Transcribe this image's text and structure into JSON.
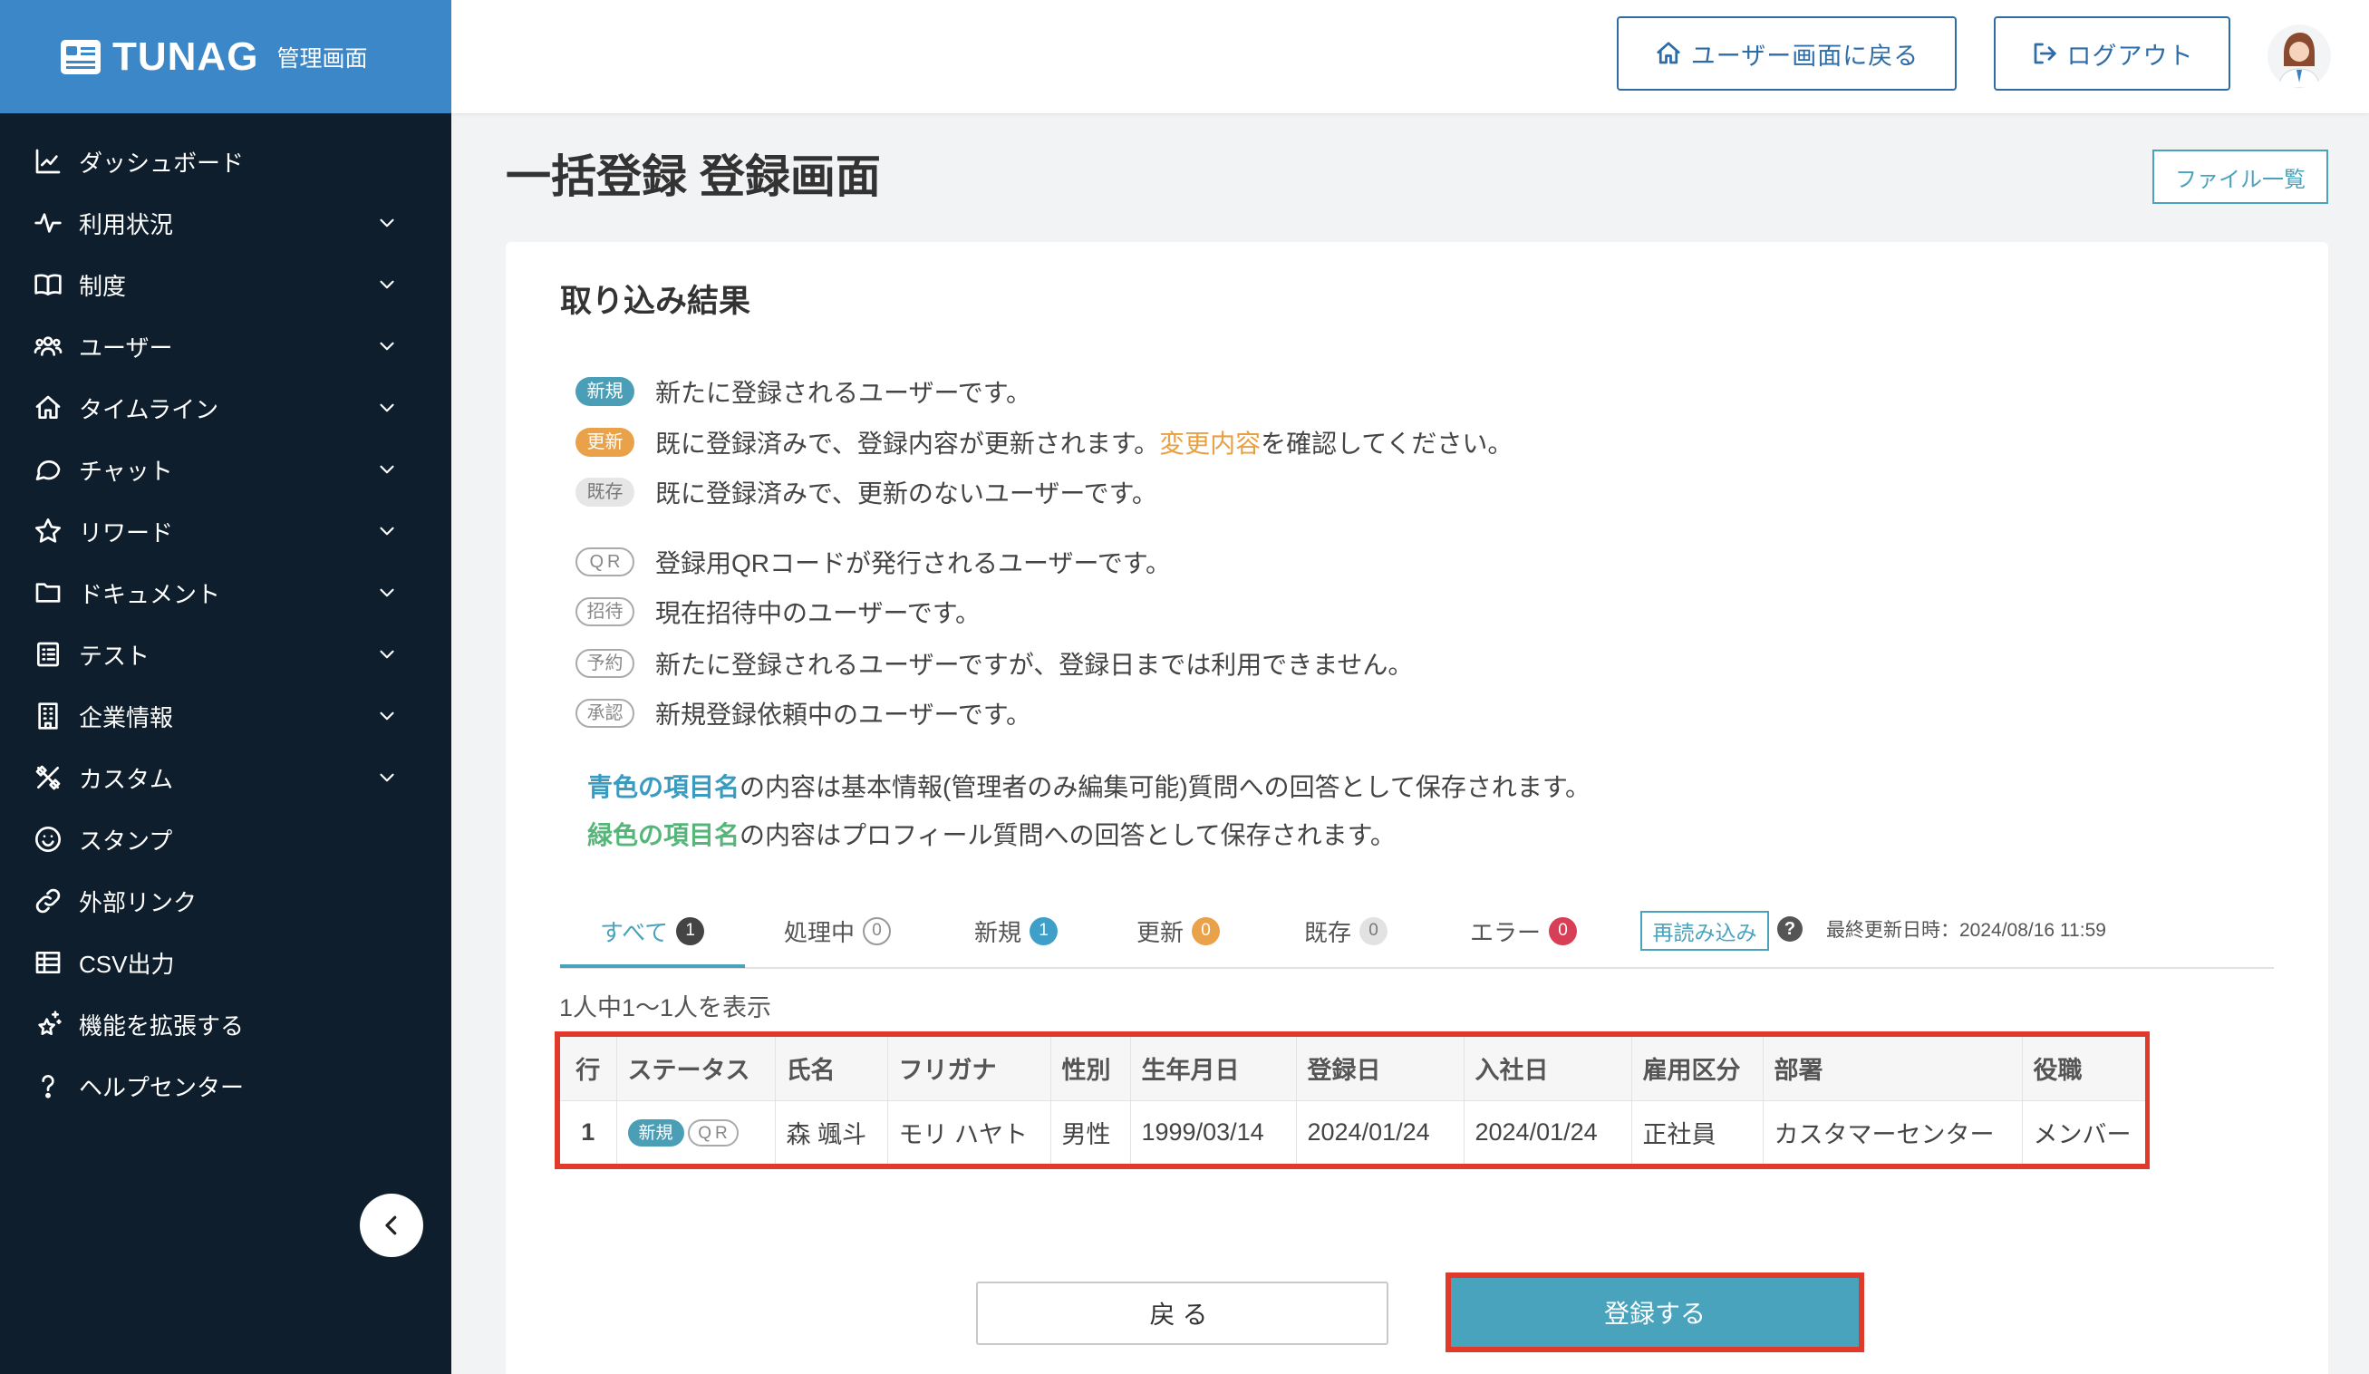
{
  "app": {
    "logo_text": "TUNAG",
    "logo_sub": "管理画面",
    "logo_icon": "tunag-logo-icon"
  },
  "sidebar": {
    "items": [
      {
        "label": "ダッシュボード",
        "icon": "chart-icon",
        "expandable": false
      },
      {
        "label": "利用状況",
        "icon": "activity-icon",
        "expandable": true
      },
      {
        "label": "制度",
        "icon": "book-icon",
        "expandable": true
      },
      {
        "label": "ユーザー",
        "icon": "users-icon",
        "expandable": true
      },
      {
        "label": "タイムライン",
        "icon": "home-icon",
        "expandable": true
      },
      {
        "label": "チャット",
        "icon": "chat-bubble-icon",
        "expandable": true
      },
      {
        "label": "リワード",
        "icon": "star-icon",
        "expandable": true
      },
      {
        "label": "ドキュメント",
        "icon": "folder-icon",
        "expandable": true
      },
      {
        "label": "テスト",
        "icon": "checklist-icon",
        "expandable": true
      },
      {
        "label": "企業情報",
        "icon": "building-icon",
        "expandable": true
      },
      {
        "label": "カスタム",
        "icon": "tools-icon",
        "expandable": true
      },
      {
        "label": "スタンプ",
        "icon": "smile-icon",
        "expandable": false
      },
      {
        "label": "外部リンク",
        "icon": "link-icon",
        "expandable": false
      },
      {
        "label": "CSV出力",
        "icon": "table-icon",
        "expandable": false
      },
      {
        "label": "機能を拡張する",
        "icon": "sparkle-icon",
        "expandable": false
      },
      {
        "label": "ヘルプセンター",
        "icon": "help-icon",
        "expandable": false
      }
    ],
    "collapse_icon": "chevron-left-icon"
  },
  "header": {
    "back_to_user_label": "ユーザー画面に戻る",
    "back_to_user_icon": "home-icon",
    "logout_label": "ログアウト",
    "logout_icon": "logout-icon"
  },
  "page": {
    "title": "一括登録 登録画面",
    "file_list_label": "ファイル一覧"
  },
  "import_result": {
    "heading": "取り込み結果",
    "legend": [
      {
        "badge": "新規",
        "text": "新たに登録されるユーザーです。"
      },
      {
        "badge": "更新",
        "text": "既に登録済みで、登録内容が更新されます。",
        "link_text": "変更内容",
        "text_after": "を確認してください。"
      },
      {
        "badge": "既存",
        "text": "既に登録済みで、更新のないユーザーです。"
      },
      {
        "badge": "QR",
        "text": "登録用QRコードが発行されるユーザーです。"
      },
      {
        "badge": "招待",
        "text": "現在招待中のユーザーです。"
      },
      {
        "badge": "予約",
        "text": "新たに登録されるユーザーですが、登録日までは利用できません。"
      },
      {
        "badge": "承認",
        "text": "新規登録依頼中のユーザーです。"
      }
    ],
    "notes": [
      {
        "highlight": "青色の項目名",
        "text": "の内容は基本情報(管理者のみ編集可能)質問への回答として保存されます。"
      },
      {
        "highlight": "緑色の項目名",
        "text": "の内容はプロフィール質問への回答として保存されます。"
      }
    ]
  },
  "tabs": [
    {
      "label": "すべて",
      "count": "1",
      "active": true
    },
    {
      "label": "処理中",
      "count": "0",
      "active": false
    },
    {
      "label": "新規",
      "count": "1",
      "active": false
    },
    {
      "label": "更新",
      "count": "0",
      "active": false
    },
    {
      "label": "既存",
      "count": "0",
      "active": false
    },
    {
      "label": "エラー",
      "count": "0",
      "active": false
    }
  ],
  "toolbar": {
    "reload_label": "再読み込み",
    "help_icon": "question-circle-icon",
    "help_glyph": "?",
    "last_updated": "最終更新日時：2024/08/16 11:59"
  },
  "pagination_text": "1人中1～1人を表示",
  "table": {
    "headers": [
      "行",
      "ステータス",
      "氏名",
      "フリガナ",
      "性別",
      "生年月日",
      "登録日",
      "入社日",
      "雇用区分",
      "部署",
      "役職"
    ],
    "rows": [
      {
        "row_no": "1",
        "status": [
          "新規",
          "QR"
        ],
        "name": "森 颯斗",
        "furigana": "モリ ハヤト",
        "gender": "男性",
        "birthdate": "1999/03/14",
        "registration_date": "2024/01/24",
        "hire_date": "2024/01/24",
        "employment_type": "正社員",
        "department": "カスタマーセンター",
        "position": "メンバー"
      }
    ]
  },
  "actions": {
    "back_label": "戻る",
    "submit_label": "登録する"
  },
  "colors": {
    "brand_blue": "#3b87c8",
    "sidebar_bg": "#0f1e2c",
    "accent_teal": "#4aa3bd",
    "badge_new": "#4a9fb7",
    "badge_update": "#e9a14a",
    "badge_error": "#d63f55",
    "annotation_red": "#e03a2a",
    "field_blue": "#3a9bc1",
    "field_green": "#56b67a"
  }
}
